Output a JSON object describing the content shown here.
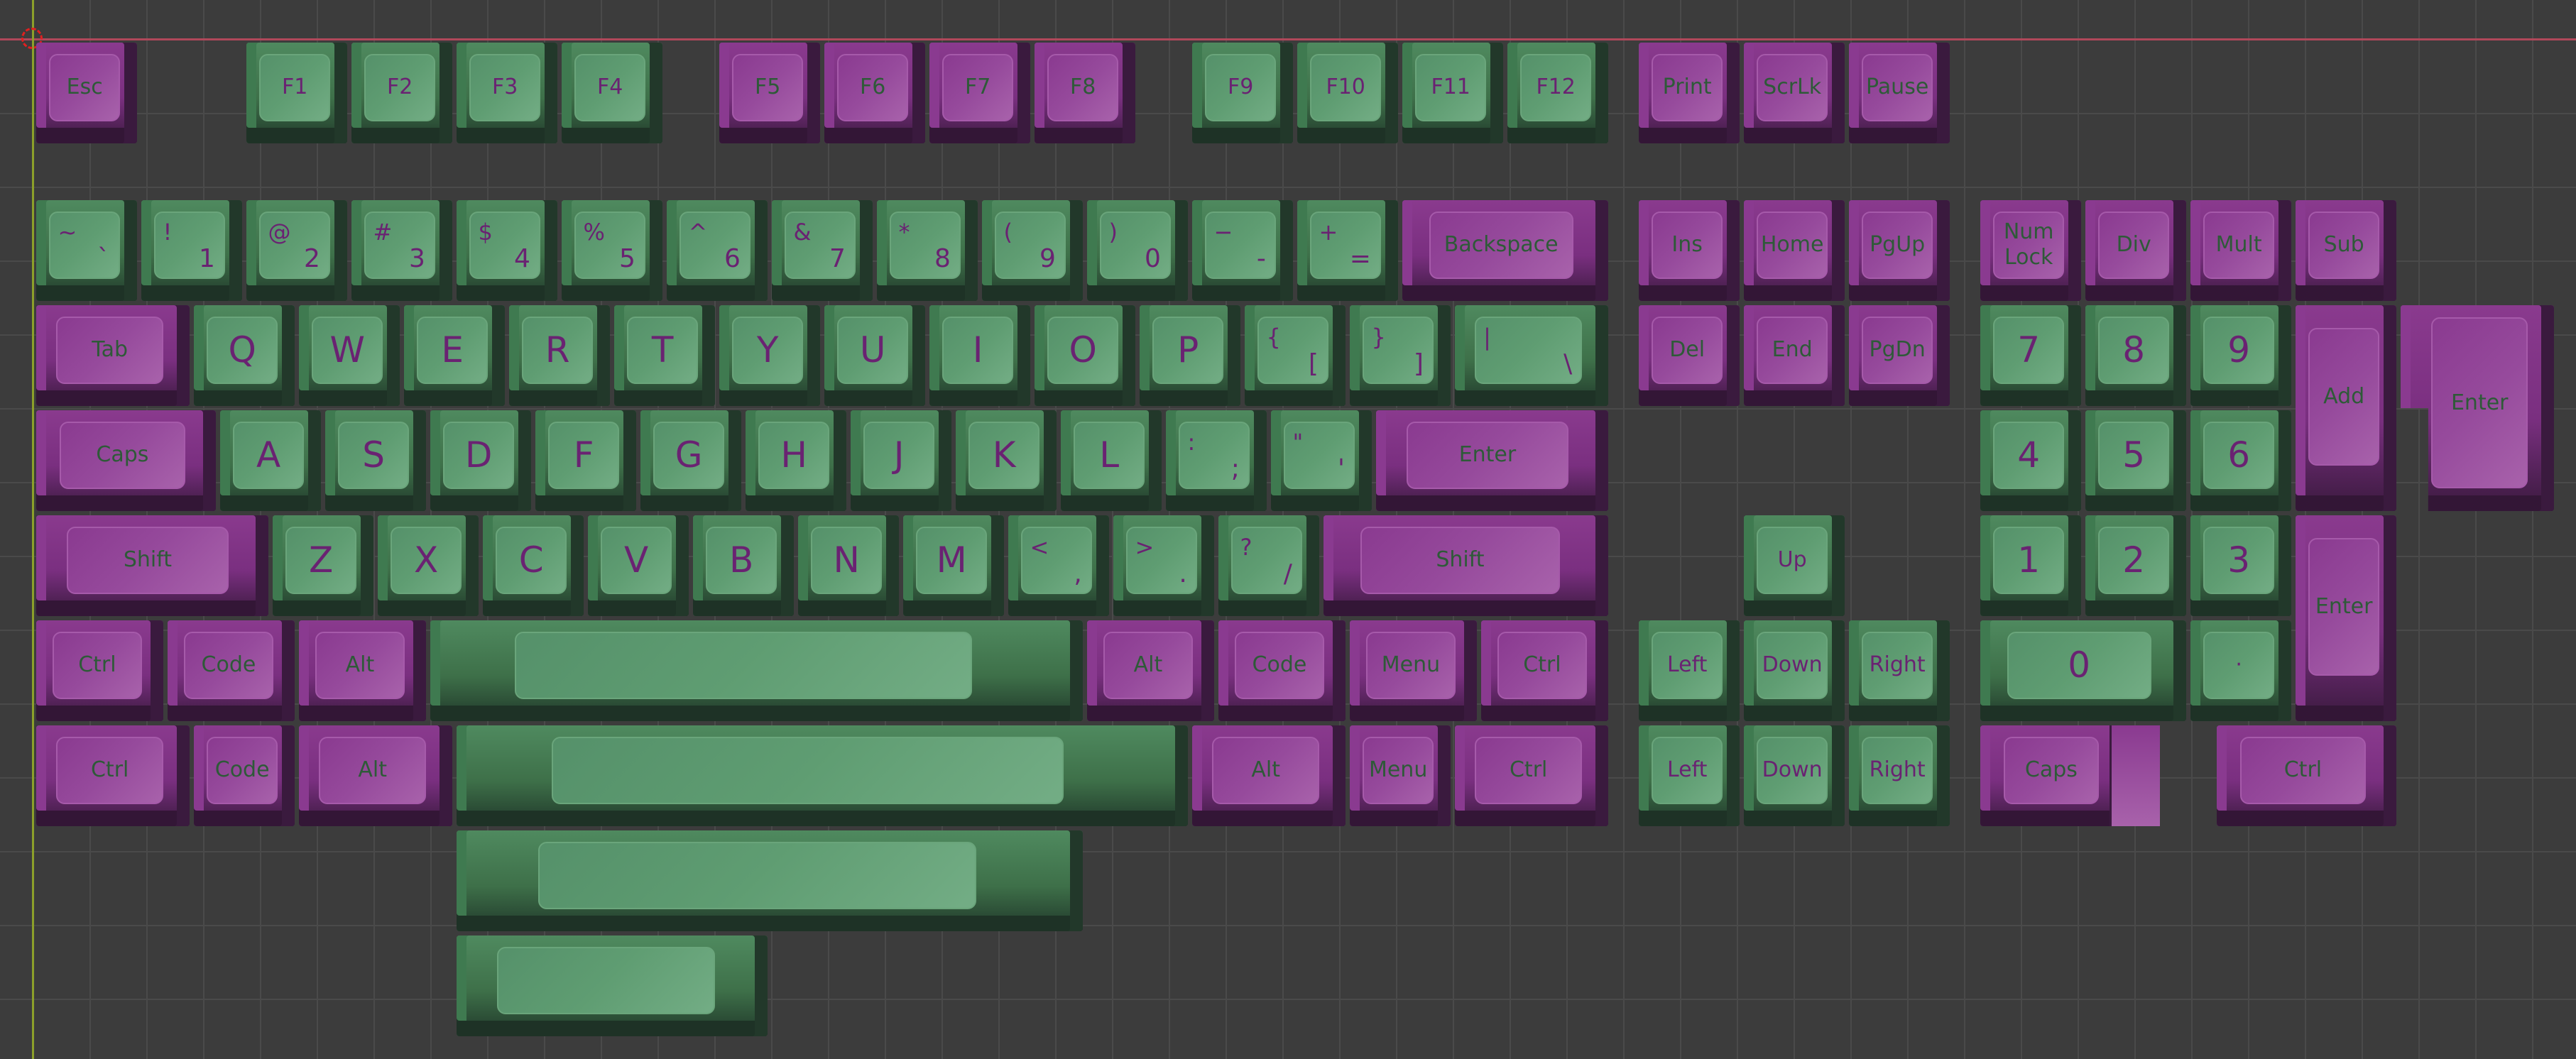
{
  "colors": {
    "green": "#5f9d72",
    "purple": "#964a9c",
    "green_legend": "#6a2272",
    "purple_legend": "#2e5a38",
    "background": "#3c3c3c"
  },
  "rows": {
    "function": [
      {
        "label": "Esc",
        "color": "purple"
      },
      {
        "label": "F1",
        "color": "green"
      },
      {
        "label": "F2",
        "color": "green"
      },
      {
        "label": "F3",
        "color": "green"
      },
      {
        "label": "F4",
        "color": "green"
      },
      {
        "label": "F5",
        "color": "purple"
      },
      {
        "label": "F6",
        "color": "purple"
      },
      {
        "label": "F7",
        "color": "purple"
      },
      {
        "label": "F8",
        "color": "purple"
      },
      {
        "label": "F9",
        "color": "green"
      },
      {
        "label": "F10",
        "color": "green"
      },
      {
        "label": "F11",
        "color": "green"
      },
      {
        "label": "F12",
        "color": "green"
      },
      {
        "label": "Print",
        "color": "purple"
      },
      {
        "label": "ScrLk",
        "color": "purple"
      },
      {
        "label": "Pause",
        "color": "purple"
      }
    ],
    "number": [
      {
        "top": "~",
        "bottom": "`",
        "color": "green"
      },
      {
        "top": "!",
        "bottom": "1",
        "color": "green"
      },
      {
        "top": "@",
        "bottom": "2",
        "color": "green"
      },
      {
        "top": "#",
        "bottom": "3",
        "color": "green"
      },
      {
        "top": "$",
        "bottom": "4",
        "color": "green"
      },
      {
        "top": "%",
        "bottom": "5",
        "color": "green"
      },
      {
        "top": "^",
        "bottom": "6",
        "color": "green"
      },
      {
        "top": "&",
        "bottom": "7",
        "color": "green"
      },
      {
        "top": "*",
        "bottom": "8",
        "color": "green"
      },
      {
        "top": "(",
        "bottom": "9",
        "color": "green"
      },
      {
        "top": ")",
        "bottom": "0",
        "color": "green"
      },
      {
        "top": "−",
        "bottom": "-",
        "color": "green"
      },
      {
        "top": "+",
        "bottom": "=",
        "color": "green"
      },
      {
        "label": "Backspace",
        "color": "purple"
      },
      {
        "label": "Ins",
        "color": "purple"
      },
      {
        "label": "Home",
        "color": "purple"
      },
      {
        "label": "PgUp",
        "color": "purple"
      },
      {
        "label": "Num\nLock",
        "color": "purple"
      },
      {
        "label": "Div",
        "color": "purple"
      },
      {
        "label": "Mult",
        "color": "purple"
      },
      {
        "label": "Sub",
        "color": "purple"
      }
    ],
    "qwerty": [
      {
        "label": "Tab",
        "color": "purple"
      },
      {
        "label": "Q",
        "alpha": true,
        "color": "green"
      },
      {
        "label": "W",
        "alpha": true,
        "color": "green"
      },
      {
        "label": "E",
        "alpha": true,
        "color": "green"
      },
      {
        "label": "R",
        "alpha": true,
        "color": "green"
      },
      {
        "label": "T",
        "alpha": true,
        "color": "green"
      },
      {
        "label": "Y",
        "alpha": true,
        "color": "green"
      },
      {
        "label": "U",
        "alpha": true,
        "color": "green"
      },
      {
        "label": "I",
        "alpha": true,
        "color": "green"
      },
      {
        "label": "O",
        "alpha": true,
        "color": "green"
      },
      {
        "label": "P",
        "alpha": true,
        "color": "green"
      },
      {
        "top": "{",
        "bottom": "[",
        "color": "green"
      },
      {
        "top": "}",
        "bottom": "]",
        "color": "green"
      },
      {
        "top": "|",
        "bottom": "\\",
        "color": "green"
      },
      {
        "label": "Del",
        "color": "purple"
      },
      {
        "label": "End",
        "color": "purple"
      },
      {
        "label": "PgDn",
        "color": "purple"
      },
      {
        "label": "7",
        "alpha": true,
        "color": "green"
      },
      {
        "label": "8",
        "alpha": true,
        "color": "green"
      },
      {
        "label": "9",
        "alpha": true,
        "color": "green"
      },
      {
        "label": "Add",
        "color": "purple"
      },
      {
        "label": "Enter",
        "color": "purple"
      }
    ],
    "home": [
      {
        "label": "Caps",
        "color": "purple"
      },
      {
        "label": "A",
        "alpha": true,
        "color": "green"
      },
      {
        "label": "S",
        "alpha": true,
        "color": "green"
      },
      {
        "label": "D",
        "alpha": true,
        "color": "green"
      },
      {
        "label": "F",
        "alpha": true,
        "color": "green"
      },
      {
        "label": "G",
        "alpha": true,
        "color": "green"
      },
      {
        "label": "H",
        "alpha": true,
        "color": "green"
      },
      {
        "label": "J",
        "alpha": true,
        "color": "green"
      },
      {
        "label": "K",
        "alpha": true,
        "color": "green"
      },
      {
        "label": "L",
        "alpha": true,
        "color": "green"
      },
      {
        "top": ":",
        "bottom": ";",
        "color": "green"
      },
      {
        "top": "\"",
        "bottom": "'",
        "color": "green"
      },
      {
        "label": "Enter",
        "color": "purple"
      },
      {
        "label": "4",
        "alpha": true,
        "color": "green"
      },
      {
        "label": "5",
        "alpha": true,
        "color": "green"
      },
      {
        "label": "6",
        "alpha": true,
        "color": "green"
      }
    ],
    "shift": [
      {
        "label": "Shift",
        "color": "purple"
      },
      {
        "label": "Z",
        "alpha": true,
        "color": "green"
      },
      {
        "label": "X",
        "alpha": true,
        "color": "green"
      },
      {
        "label": "C",
        "alpha": true,
        "color": "green"
      },
      {
        "label": "V",
        "alpha": true,
        "color": "green"
      },
      {
        "label": "B",
        "alpha": true,
        "color": "green"
      },
      {
        "label": "N",
        "alpha": true,
        "color": "green"
      },
      {
        "label": "M",
        "alpha": true,
        "color": "green"
      },
      {
        "top": "<",
        "bottom": ",",
        "color": "green"
      },
      {
        "top": ">",
        "bottom": ".",
        "color": "green"
      },
      {
        "top": "?",
        "bottom": "/",
        "color": "green"
      },
      {
        "label": "Shift",
        "color": "purple"
      },
      {
        "label": "Up",
        "color": "green"
      },
      {
        "label": "1",
        "alpha": true,
        "color": "green"
      },
      {
        "label": "2",
        "alpha": true,
        "color": "green"
      },
      {
        "label": "3",
        "alpha": true,
        "color": "green"
      },
      {
        "label": "Enter",
        "color": "purple"
      }
    ],
    "bottom_a": [
      {
        "label": "Ctrl",
        "color": "purple"
      },
      {
        "label": "Code",
        "color": "purple"
      },
      {
        "label": "Alt",
        "color": "purple"
      },
      {
        "label": "",
        "color": "green"
      },
      {
        "label": "Alt",
        "color": "purple"
      },
      {
        "label": "Code",
        "color": "purple"
      },
      {
        "label": "Menu",
        "color": "purple"
      },
      {
        "label": "Ctrl",
        "color": "purple"
      },
      {
        "label": "Left",
        "color": "green"
      },
      {
        "label": "Down",
        "color": "green"
      },
      {
        "label": "Right",
        "color": "green"
      },
      {
        "label": "0",
        "alpha": true,
        "color": "green"
      },
      {
        "label": "·",
        "color": "green"
      }
    ],
    "bottom_b": [
      {
        "label": "Ctrl",
        "color": "purple"
      },
      {
        "label": "Code",
        "color": "purple"
      },
      {
        "label": "Alt",
        "color": "purple"
      },
      {
        "label": "",
        "color": "green"
      },
      {
        "label": "Alt",
        "color": "purple"
      },
      {
        "label": "Menu",
        "color": "purple"
      },
      {
        "label": "Ctrl",
        "color": "purple"
      },
      {
        "label": "Left",
        "color": "green"
      },
      {
        "label": "Down",
        "color": "green"
      },
      {
        "label": "Right",
        "color": "green"
      },
      {
        "label": "Caps",
        "color": "purple"
      },
      {
        "label": "Ctrl",
        "color": "purple"
      }
    ],
    "extra": [
      {
        "label": "",
        "color": "green"
      },
      {
        "label": "",
        "color": "green"
      }
    ]
  }
}
